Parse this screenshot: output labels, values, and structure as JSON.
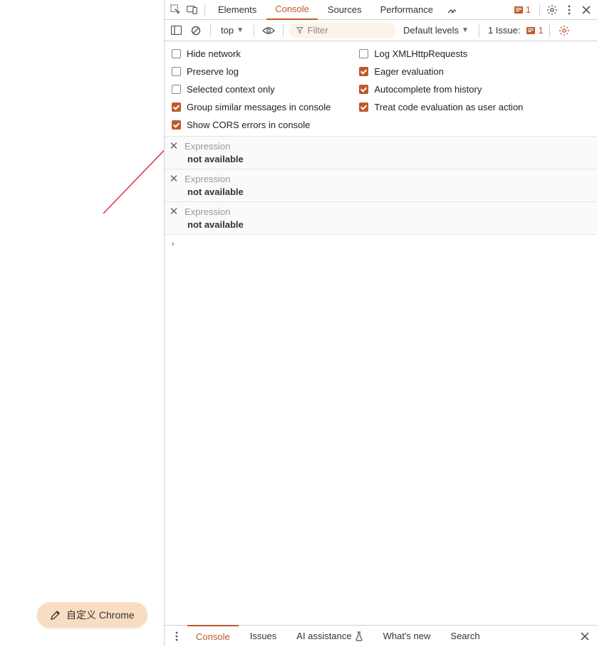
{
  "tabs": {
    "items": [
      "Elements",
      "Console",
      "Sources",
      "Performance"
    ],
    "active": "Console",
    "error_count": "1"
  },
  "toolbar": {
    "context": "top",
    "filter_placeholder": "Filter",
    "levels": "Default levels",
    "issues_label": "1 Issue:",
    "issues_count": "1"
  },
  "settings": {
    "left": [
      {
        "label": "Hide network",
        "checked": false
      },
      {
        "label": "Preserve log",
        "checked": false
      },
      {
        "label": "Selected context only",
        "checked": false
      },
      {
        "label": "Group similar messages in console",
        "checked": true
      },
      {
        "label": "Show CORS errors in console",
        "checked": true
      }
    ],
    "right": [
      {
        "label": "Log XMLHttpRequests",
        "checked": false
      },
      {
        "label": "Eager evaluation",
        "checked": true
      },
      {
        "label": "Autocomplete from history",
        "checked": true
      },
      {
        "label": "Treat code evaluation as user action",
        "checked": true
      }
    ]
  },
  "expressions": [
    {
      "label": "Expression",
      "value": "not available"
    },
    {
      "label": "Expression",
      "value": "not available"
    },
    {
      "label": "Expression",
      "value": "not available"
    }
  ],
  "drawer": {
    "tabs": [
      "Console",
      "Issues",
      "AI assistance",
      "What's new",
      "Search"
    ],
    "active": "Console"
  },
  "customize": {
    "label": "自定义 Chrome"
  }
}
